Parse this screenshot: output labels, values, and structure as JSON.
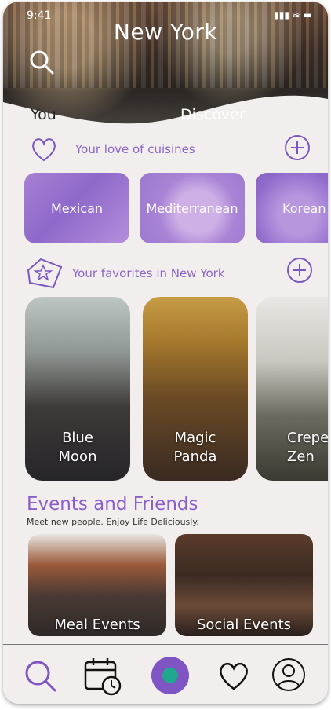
{
  "status_bar": {
    "time": "9:41",
    "icons": "▮▮▮ ≋ ▬"
  },
  "header": {
    "city": "New York"
  },
  "tabs": [
    {
      "label": "You"
    },
    {
      "label": "Discover"
    }
  ],
  "cuisines_section": {
    "title": "Your love of cuisines",
    "items": [
      {
        "label": "Mexican"
      },
      {
        "label": "Mediterranean"
      },
      {
        "label": "Korean"
      }
    ]
  },
  "favorites_section": {
    "title": "Your favorites in New York",
    "items": [
      {
        "line1": "Blue",
        "line2": "Moon"
      },
      {
        "line1": "Magic",
        "line2": "Panda"
      },
      {
        "line1": "Crepe",
        "line2": "Zen"
      }
    ]
  },
  "events_section": {
    "title": "Events and Friends",
    "subtitle": "Meet new people. Enjoy Life Deliciously.",
    "items": [
      {
        "label": "Meal Events"
      },
      {
        "label": "Social Events"
      }
    ]
  },
  "nav": [
    "search-icon",
    "calendar-clock-icon",
    "home-icon",
    "heart-icon",
    "profile-icon"
  ],
  "colors": {
    "accent": "#7f55c4",
    "teal": "#1fa88d",
    "background": "#f3eeee"
  }
}
